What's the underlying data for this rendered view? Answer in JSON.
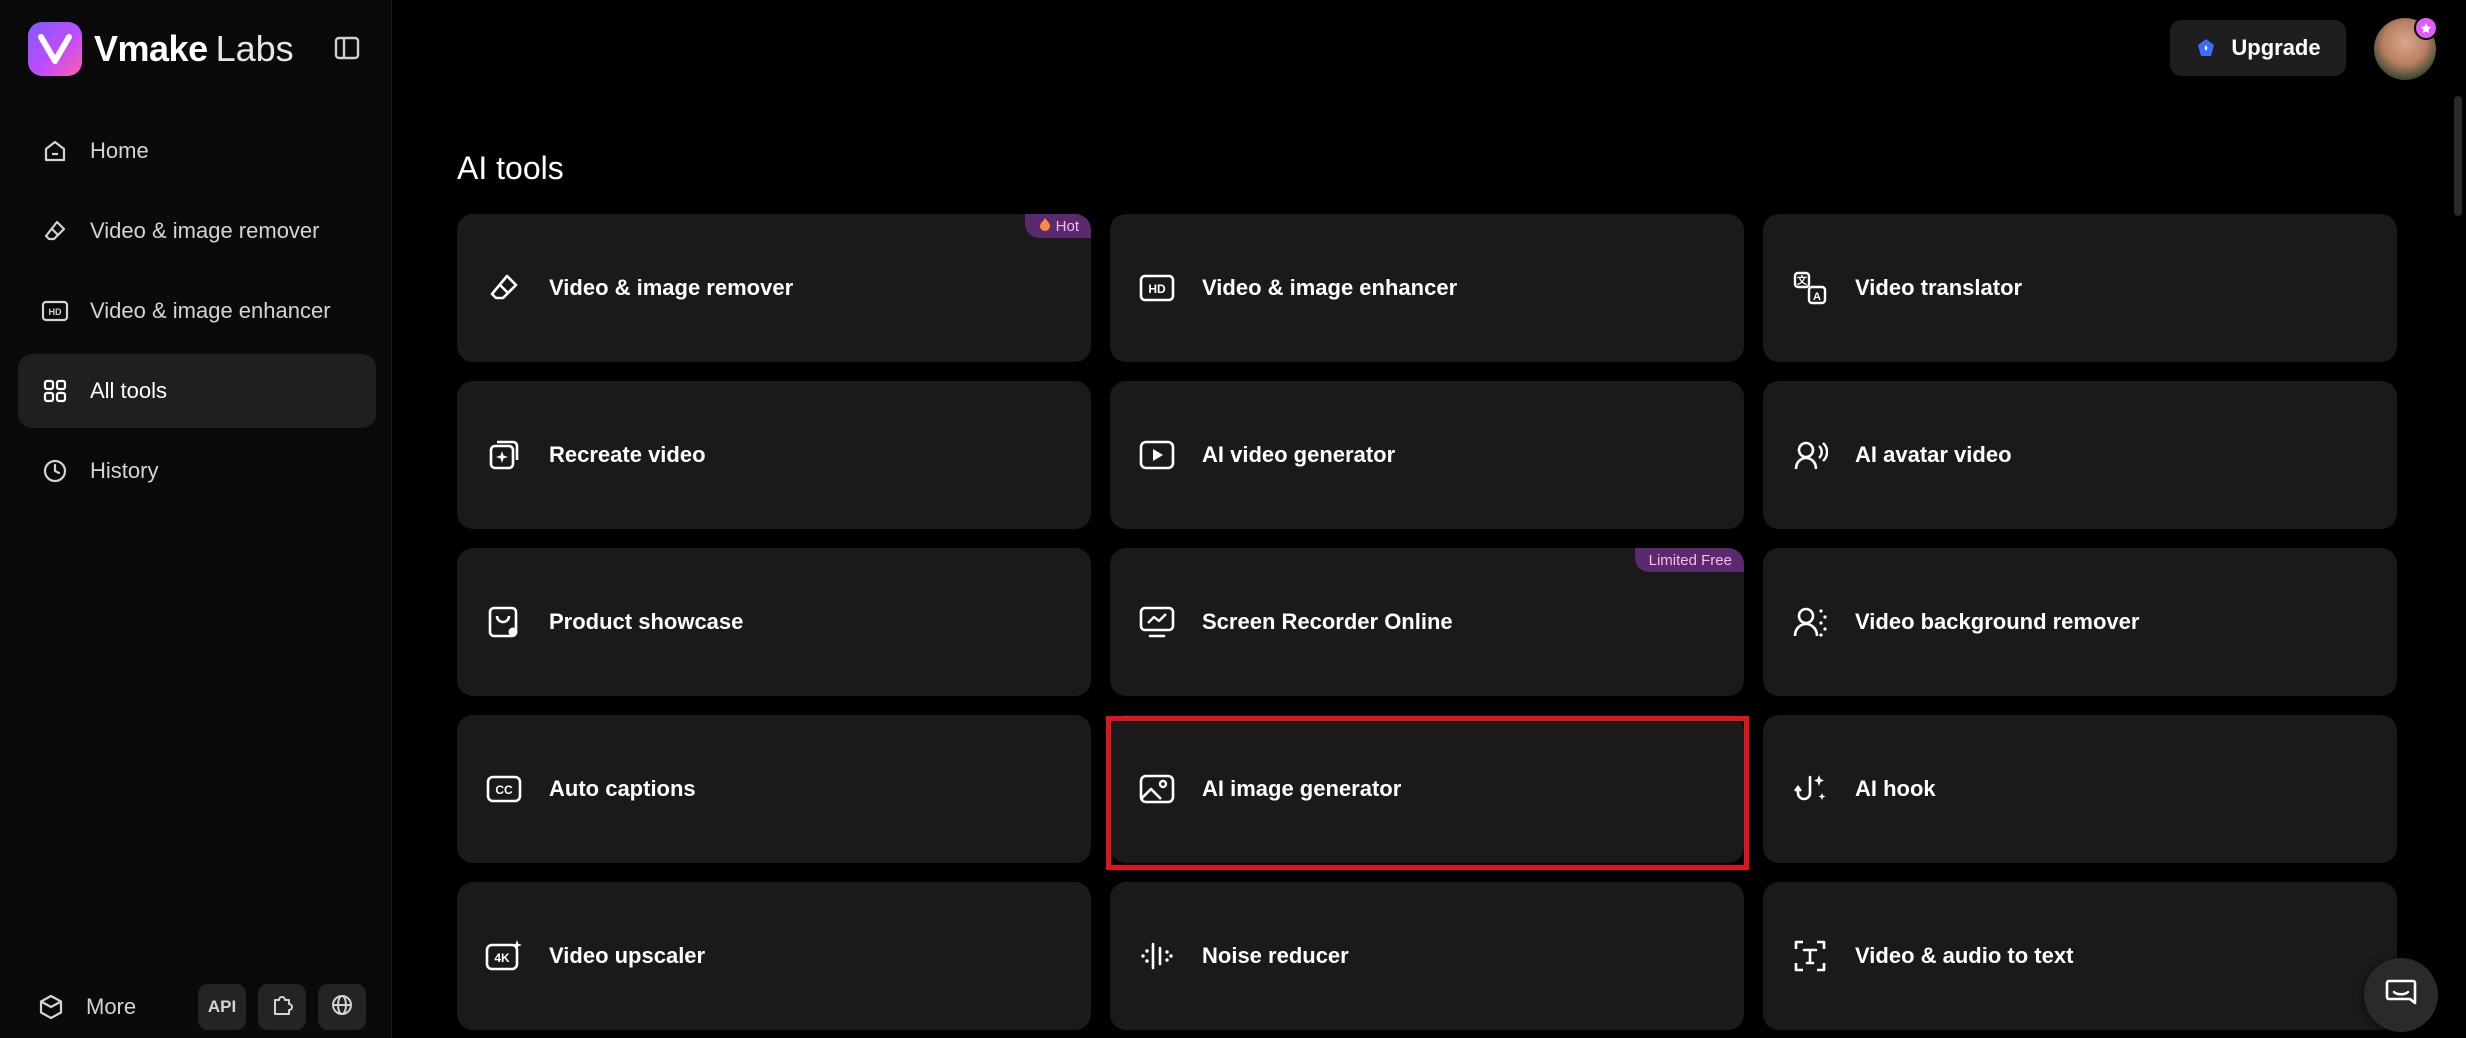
{
  "brand": {
    "name": "Vmake",
    "sub": "Labs"
  },
  "sidebar": {
    "items": [
      {
        "label": "Home",
        "icon": "home-icon",
        "active": false
      },
      {
        "label": "Video & image remover",
        "icon": "eraser-icon",
        "active": false
      },
      {
        "label": "Video & image enhancer",
        "icon": "hd-icon",
        "active": false
      },
      {
        "label": "All tools",
        "icon": "grid-icon",
        "active": true
      },
      {
        "label": "History",
        "icon": "clock-icon",
        "active": false
      }
    ],
    "more_label": "More",
    "api_label": "API"
  },
  "header": {
    "upgrade_label": "Upgrade"
  },
  "main": {
    "title": "AI tools",
    "tools": [
      {
        "label": "Video & image remover",
        "icon": "eraser-icon",
        "badge": "Hot"
      },
      {
        "label": "Video & image enhancer",
        "icon": "hd-icon"
      },
      {
        "label": "Video translator",
        "icon": "translate-icon"
      },
      {
        "label": "Recreate video",
        "icon": "recreate-icon"
      },
      {
        "label": "AI video generator",
        "icon": "play-icon"
      },
      {
        "label": "AI avatar video",
        "icon": "avatar-icon"
      },
      {
        "label": "Product showcase",
        "icon": "product-icon"
      },
      {
        "label": "Screen Recorder Online",
        "icon": "screen-recorder-icon",
        "badge": "Limited Free"
      },
      {
        "label": "Video background remover",
        "icon": "bg-remover-icon"
      },
      {
        "label": "Auto captions",
        "icon": "captions-icon"
      },
      {
        "label": "AI image generator",
        "icon": "image-icon",
        "highlighted": true
      },
      {
        "label": "AI hook",
        "icon": "hook-icon"
      },
      {
        "label": "Video upscaler",
        "icon": "4k-icon"
      },
      {
        "label": "Noise reducer",
        "icon": "noise-icon"
      },
      {
        "label": "Video & audio to text",
        "icon": "text-icon"
      }
    ]
  },
  "colors": {
    "background": "#000000",
    "card": "#1a1a1a",
    "active_nav": "#1f1f1f",
    "highlight": "#e0141e",
    "badge": "#5a2a6e"
  }
}
